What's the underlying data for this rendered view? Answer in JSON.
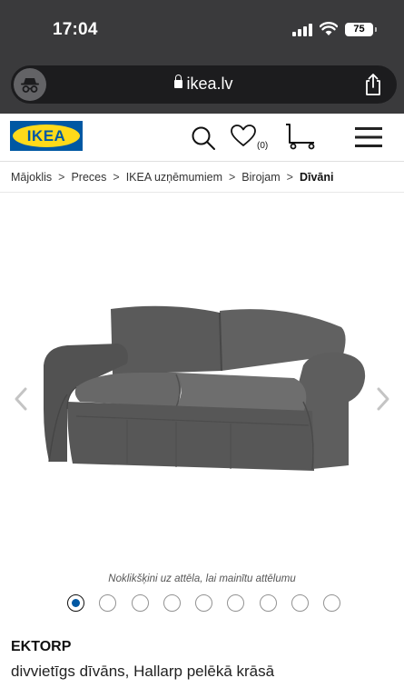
{
  "status_bar": {
    "time": "17:04",
    "battery": "75"
  },
  "browser": {
    "url": "ikea.lv",
    "icons": [
      "incognito-icon",
      "lock-icon",
      "share-icon"
    ]
  },
  "header": {
    "logo_text": "IKEA",
    "favorites_count": "(0)",
    "icons": [
      "search-icon",
      "heart-icon",
      "cart-icon",
      "menu-icon"
    ]
  },
  "breadcrumb": {
    "items": [
      "Mājoklis",
      "Preces",
      "IKEA uzņēmumiem",
      "Birojam"
    ],
    "separator": ">",
    "current": "Dīvāni"
  },
  "gallery": {
    "caption": "Noklikšķini uz attēla, lai mainītu attēlumu",
    "dot_count": 9,
    "active_index": 0
  },
  "product": {
    "name": "EKTORP",
    "description": "divvietīgs dīvāns, Hallarp pelēkā krāsā"
  },
  "colors": {
    "chrome": "#3a3a3c",
    "ikea_blue": "#0058a3",
    "ikea_yellow": "#ffda1a",
    "sofa": "#595959"
  }
}
